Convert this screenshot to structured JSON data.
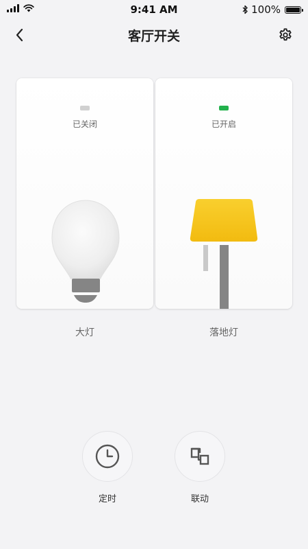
{
  "status_bar": {
    "time": "9:41 AM",
    "battery": "100%",
    "battery_level": 1.0
  },
  "nav": {
    "title": "客厅开关",
    "back_icon": "chevron-left-icon",
    "settings_icon": "gear-icon"
  },
  "switches": [
    {
      "name": "大灯",
      "state": "已关闭",
      "on": false,
      "indicator_color": "#d0d0d0",
      "icon": "bulb-icon"
    },
    {
      "name": "落地灯",
      "state": "已开启",
      "on": true,
      "indicator_color": "#22b14c",
      "lamp_color": "#f7c51e",
      "icon": "floor-lamp-icon"
    }
  ],
  "actions": [
    {
      "label": "定时",
      "icon": "clock-icon"
    },
    {
      "label": "联动",
      "icon": "link-icon"
    }
  ],
  "colors": {
    "background": "#f3f3f5",
    "switch_on": "#22b14c",
    "switch_off": "#d0d0d0",
    "lamp_shade": "#f7c51e"
  }
}
